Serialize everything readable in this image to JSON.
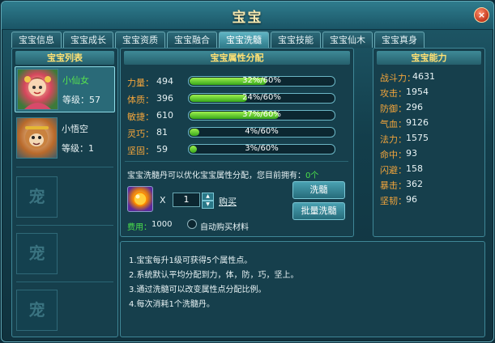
{
  "window": {
    "title": "宝宝",
    "close_label": "×"
  },
  "tabs": [
    {
      "label": "宝宝信息"
    },
    {
      "label": "宝宝成长"
    },
    {
      "label": "宝宝资质"
    },
    {
      "label": "宝宝融合"
    },
    {
      "label": "宝宝洗髓",
      "active": true
    },
    {
      "label": "宝宝技能"
    },
    {
      "label": "宝宝仙木"
    },
    {
      "label": "宝宝真身"
    }
  ],
  "pet_list": {
    "header": "宝宝列表",
    "pets": [
      {
        "name": "小仙女",
        "level_label": "等级：",
        "level": "57",
        "selected": true
      },
      {
        "name": "小悟空",
        "level_label": "等级：",
        "level": "1",
        "selected": false
      }
    ],
    "empty_slot_glyph": "宠"
  },
  "attributes": {
    "header": "宝宝属性分配",
    "rows": [
      {
        "label": "力量：",
        "value": "494",
        "percent": 32,
        "text": "32%/60%"
      },
      {
        "label": "体质：",
        "value": "396",
        "percent": 24,
        "text": "24%/60%"
      },
      {
        "label": "敏捷：",
        "value": "610",
        "percent": 37,
        "text": "37%/60%"
      },
      {
        "label": "灵巧：",
        "value": "81",
        "percent": 4,
        "text": "4%/60%"
      },
      {
        "label": "坚固：",
        "value": "59",
        "percent": 3,
        "text": "3%/60%"
      }
    ]
  },
  "wash": {
    "info_text": "宝宝洗髓丹可以优化宝宝属性分配，您目前拥有：",
    "owned": "0个",
    "multiplier": "X",
    "quantity": "1",
    "buy_label": "购买",
    "wash_button": "洗髓",
    "batch_button": "批量洗髓",
    "cost_label": "费用：",
    "cost_value": "1000",
    "auto_buy_label": "自动购买材料"
  },
  "abilities": {
    "header": "宝宝能力",
    "rows": [
      {
        "label": "战斗力：",
        "value": "4631"
      },
      {
        "label": "攻击：",
        "value": "1954"
      },
      {
        "label": "防御：",
        "value": "296"
      },
      {
        "label": "气血：",
        "value": "9126"
      },
      {
        "label": "法力：",
        "value": "1575"
      },
      {
        "label": "命中：",
        "value": "93"
      },
      {
        "label": "闪避：",
        "value": "158"
      },
      {
        "label": "暴击：",
        "value": "362"
      },
      {
        "label": "坚韧：",
        "value": "96"
      }
    ]
  },
  "notes": [
    "1.宝宝每升1级可获得5个属性点。",
    "2.系统默认平均分配到力，体，防，巧，坚上。",
    "3.通过洗髓可以改变属性点分配比例。",
    "4.每次消耗1个洗髓丹。"
  ],
  "colors": {
    "accent": "#ffe173",
    "label_orange": "#f3a53b",
    "bar_green": "#5fd02a",
    "owned_green": "#4be04b"
  }
}
